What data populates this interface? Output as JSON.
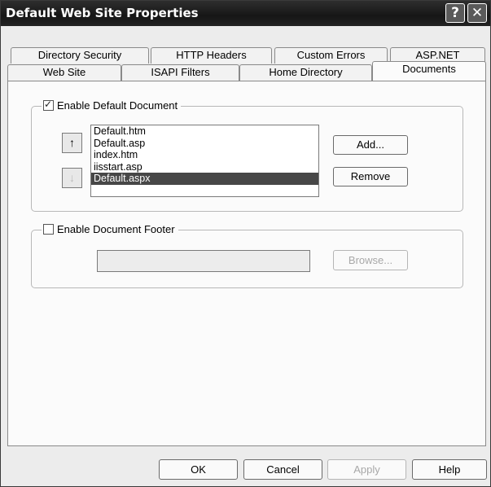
{
  "window": {
    "title": "Default Web Site Properties",
    "help_glyph": "?",
    "close_glyph": "✕"
  },
  "tabs": {
    "row_back": [
      "Directory Security",
      "HTTP Headers",
      "Custom Errors",
      "ASP.NET"
    ],
    "row_front": [
      "Web Site",
      "ISAPI Filters",
      "Home Directory",
      "Documents"
    ],
    "active": "Documents"
  },
  "default_document": {
    "checkbox_label": "Enable Default Document",
    "checked": true,
    "up_glyph": "↑",
    "down_glyph": "↓",
    "documents": [
      "Default.htm",
      "Default.asp",
      "index.htm",
      "iisstart.asp",
      "Default.aspx"
    ],
    "selected": "Default.aspx",
    "add_label": "Add...",
    "remove_label": "Remove"
  },
  "footer": {
    "checkbox_label": "Enable Document Footer",
    "checked": false,
    "path_value": "",
    "browse_label": "Browse..."
  },
  "buttons": {
    "ok": "OK",
    "cancel": "Cancel",
    "apply": "Apply",
    "help": "Help"
  }
}
